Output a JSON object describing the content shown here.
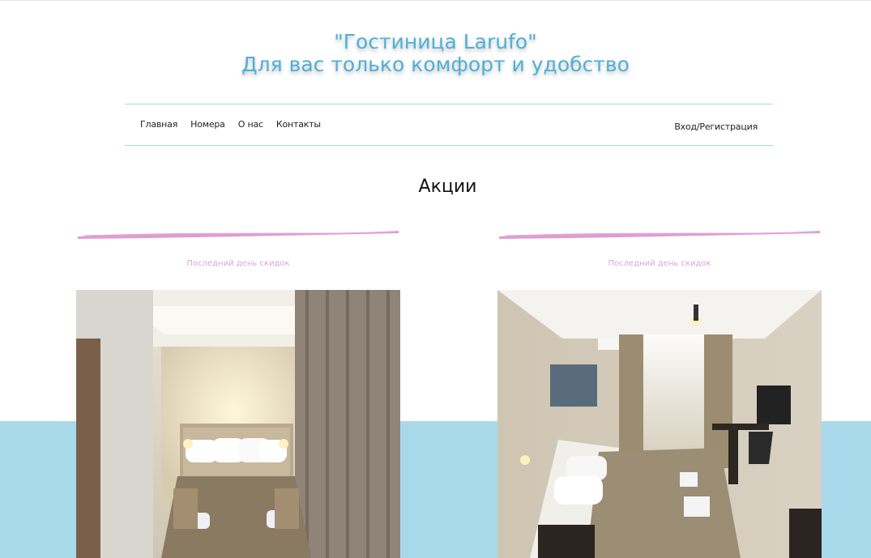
{
  "header": {
    "title_line1": "\"Гостиница Larufo\"",
    "title_line2": "Для вас только комфорт и удобство"
  },
  "nav": {
    "items": [
      {
        "label": "Главная"
      },
      {
        "label": "Номера"
      },
      {
        "label": "О нас"
      },
      {
        "label": "Контакты"
      }
    ],
    "login_label": "Вход/Регистрация"
  },
  "promotions": {
    "title": "Акции",
    "cards": [
      {
        "caption": "Последний день скидок"
      },
      {
        "caption": "Последний день скидок"
      }
    ]
  },
  "colors": {
    "accent": "#4fb0d6",
    "band": "#a8d9ea",
    "brush": "#d98cc7",
    "caption": "#d8a6d6"
  }
}
